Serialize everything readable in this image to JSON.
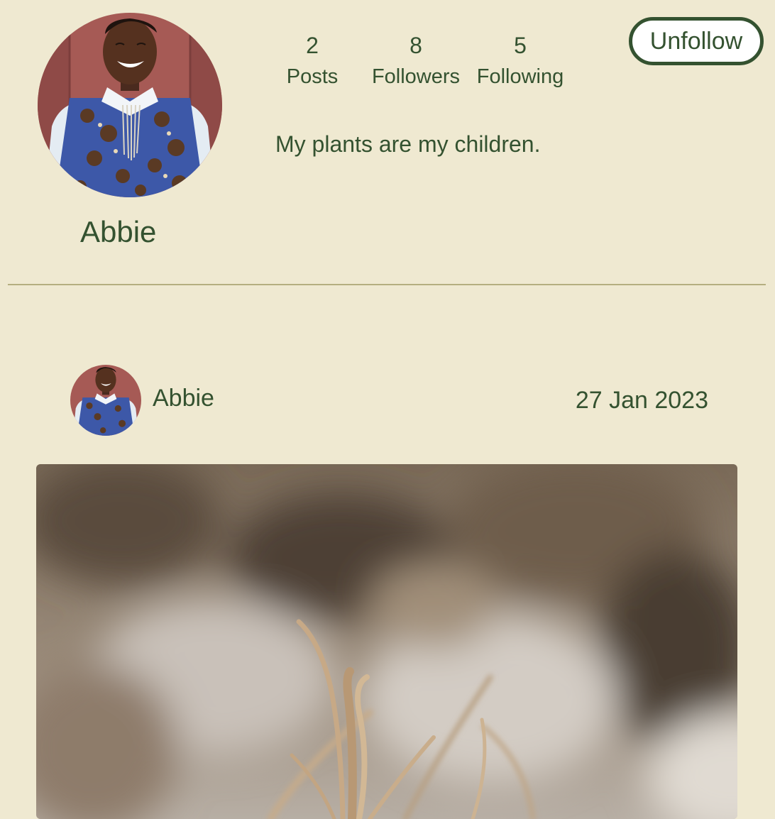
{
  "profile": {
    "name": "Abbie",
    "bio": "My plants are my children.",
    "stats": [
      {
        "count": "2",
        "label": "Posts"
      },
      {
        "count": "8",
        "label": "Followers"
      },
      {
        "count": "5",
        "label": "Following"
      }
    ],
    "unfollow_label": "Unfollow"
  },
  "post": {
    "author": "Abbie",
    "date": "27 Jan 2023"
  },
  "colors": {
    "background": "#efe9d1",
    "text": "#345230",
    "divider": "#b4ae80",
    "button_fill": "#ffffff"
  }
}
